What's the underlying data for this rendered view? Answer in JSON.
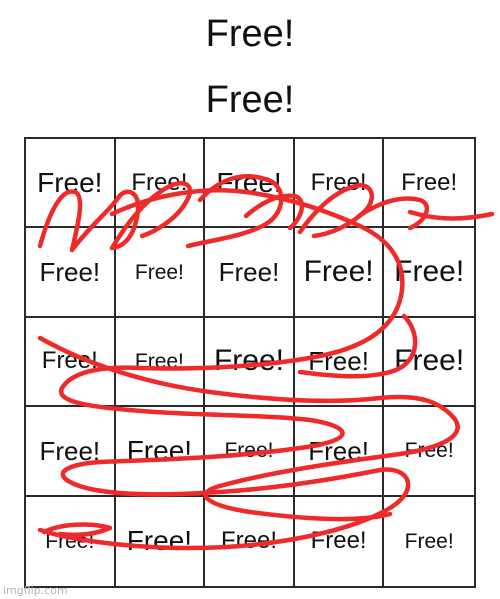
{
  "title_lines": [
    "Free!",
    "Free!"
  ],
  "cells": [
    "Free!",
    "Free!",
    "Free!",
    "Free!",
    "Free!",
    "Free!",
    "Free!",
    "Free!",
    "Free!",
    "Free!",
    "Free!",
    "Free!",
    "Free!",
    "Free!",
    "Free!",
    "Free!",
    "Free!",
    "Free!",
    "Free!",
    "Free!",
    "Free!",
    "Free!",
    "Free!",
    "Free!",
    "Free!"
  ],
  "scribble_color": "#ee2a2a",
  "watermark": "imgflip.com"
}
